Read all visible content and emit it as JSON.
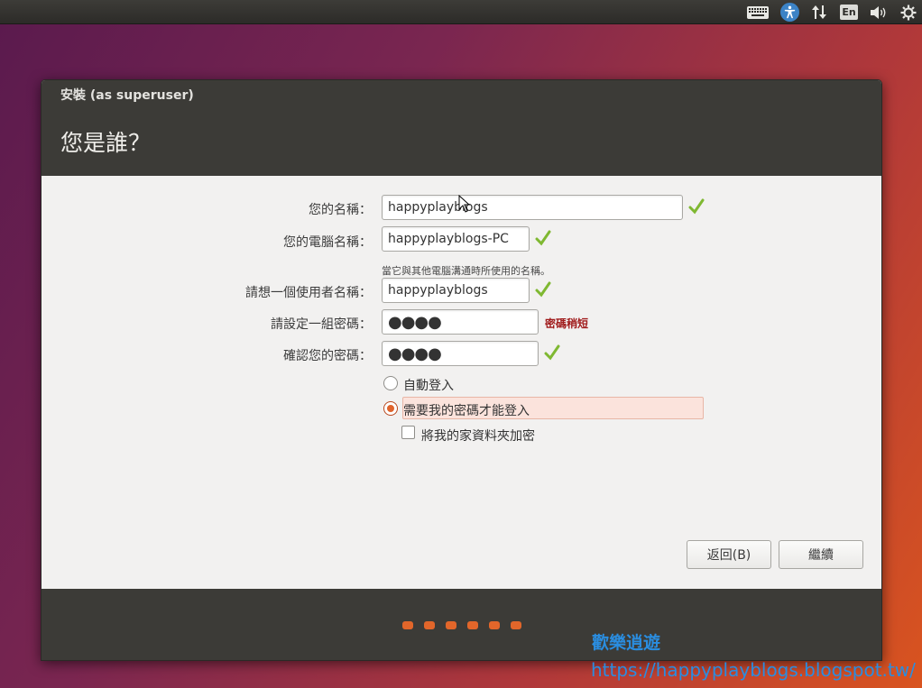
{
  "panel": {
    "lang_indicator": "En",
    "icons": [
      "keyboard-icon",
      "accessibility-icon",
      "network-icon",
      "language-icon",
      "volume-icon",
      "power-icon"
    ]
  },
  "window": {
    "title": "安裝 (as superuser)",
    "heading": "您是誰？"
  },
  "form": {
    "name_label": "您的名稱：",
    "name_value": "happyplayblogs",
    "computer_label": "您的電腦名稱：",
    "computer_value": "happyplayblogs-PC",
    "computer_hint": "當它與其他電腦溝通時所使用的名稱。",
    "username_label": "請想一個使用者名稱：",
    "username_value": "happyplayblogs",
    "password_label": "請設定一組密碼：",
    "password_value": "●●●●",
    "password_strength": "密碼稍短",
    "confirm_label": "確認您的密碼：",
    "confirm_value": "●●●●"
  },
  "login_options": {
    "auto_login": "自動登入",
    "require_password": "需要我的密碼才能登入",
    "encrypt_home": "將我的家資料夾加密",
    "selected": "require_password",
    "encrypt_checked": false
  },
  "buttons": {
    "back": "返回(B)",
    "continue": "繼續"
  },
  "progress": {
    "total_steps": 6
  },
  "watermark": {
    "line1": "歡樂逍遊",
    "line2": "https://happyplayblogs.blogspot.tw/"
  },
  "colors": {
    "accent": "#e0642c",
    "check": "#7fb831",
    "error": "#a01b1b",
    "header": "#3c3b37"
  }
}
